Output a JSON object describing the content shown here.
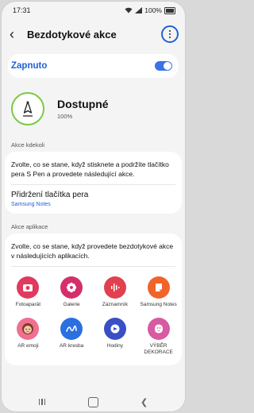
{
  "status_bar": {
    "time": "17:31",
    "battery": "100%"
  },
  "header": {
    "title": "Bezdotykové akce"
  },
  "master_switch": {
    "label": "Zapnuto",
    "on": true
  },
  "pen": {
    "status": "Dostupné",
    "battery": "100%"
  },
  "section_kdekoli": {
    "label": "Akce kdekoli",
    "description": "Zvolte, co se stane, když stisknete a podržíte tlačítko pera S Pen a provedete následující akce.",
    "pref_title": "Přidržení tlačítka pera",
    "pref_value": "Samsung Notes"
  },
  "section_apps": {
    "label": "Akce aplikace",
    "description": "Zvolte, co se stane, když provedete bezdotykové akce v následujících aplikacích.",
    "apps": [
      {
        "label": "Fotoaparát",
        "icon": "camera-icon",
        "color": "#e03a5e"
      },
      {
        "label": "Galerie",
        "icon": "gallery-flower-icon",
        "color": "#d42f6b"
      },
      {
        "label": "Záznamník",
        "icon": "voice-recorder-icon",
        "color": "#e04050"
      },
      {
        "label": "Samsung Notes",
        "icon": "notes-icon",
        "color": "#f0642b"
      },
      {
        "label": "AR emoji",
        "icon": "ar-emoji-icon",
        "color": "#f07090"
      },
      {
        "label": "AR kresba",
        "icon": "ar-doodle-icon",
        "color": "#2b6fe0"
      },
      {
        "label": "Hodiny",
        "icon": "clock-icon",
        "color": "#3a4fc4"
      },
      {
        "label": "VÝBĚR DEKORACE",
        "icon": "deco-pic-icon",
        "color": "#d85aa0"
      }
    ]
  },
  "colors": {
    "accent": "#1e62d8",
    "pen_ring": "#7ac943"
  }
}
